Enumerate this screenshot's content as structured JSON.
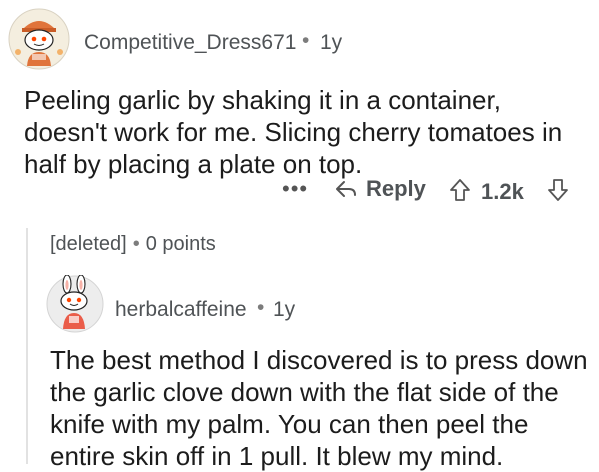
{
  "comment1": {
    "author": "Competitive_Dress671",
    "separator": "•",
    "age": "1y",
    "body": "Peeling garlic by shaking it in a container, doesn't work for me. Slicing cherry tomatoes in half by placing a plate on top.",
    "more_label": "•••",
    "reply_label": "Reply",
    "score": "1.2k"
  },
  "deleted_comment": {
    "author": "[deleted]",
    "separator": "•",
    "points": "0 points"
  },
  "comment2": {
    "author": "herbalcaffeine",
    "separator": "•",
    "age": "1y",
    "body": "The best method I discovered is to press down the garlic clove down with the flat side of the knife with my palm. You can then peel the entire skin off in 1 pull. It blew my mind."
  },
  "icons": {
    "avatar1": "snoo-avatar-icon",
    "avatar2": "snoo-bunny-avatar-icon",
    "reply": "reply-arrow-icon",
    "upvote": "upvote-arrow-icon",
    "downvote": "downvote-arrow-icon"
  },
  "colors": {
    "meta_text": "#4f5356",
    "body_text": "#1c1c1c",
    "thread_line": "#e2e2e2",
    "avatar_bg": "#f4eedf"
  }
}
